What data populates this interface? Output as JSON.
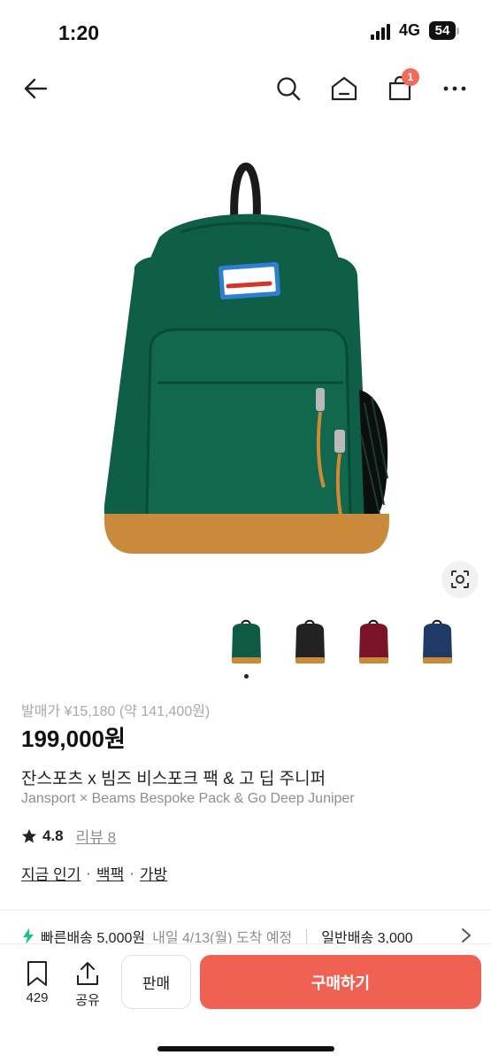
{
  "status_bar": {
    "time": "1:20",
    "network": "4G",
    "battery": "54"
  },
  "nav": {
    "cart_count": "1"
  },
  "product": {
    "release_price": "발매가 ¥15,180 (약 141,400원)",
    "price": "199,000원",
    "title_ko": "잔스포츠 x 빔즈 비스포크 팩 & 고 딥 주니퍼",
    "title_en": "Jansport × Beams Bespoke Pack & Go Deep Juniper",
    "rating": "4.8",
    "review_label": "리뷰 8",
    "tags": [
      "지금 인기",
      "백팩",
      "가방"
    ],
    "tag_separator": "·"
  },
  "thumbnails": {
    "colors": [
      "#0e5a45",
      "#222222",
      "#7a1428",
      "#1f3a66"
    ],
    "selected_index": 0
  },
  "delivery": {
    "fast_label": "빠른배송 5,000원",
    "fast_eta": "내일 4/13(월) 도착 예정",
    "standard_label": "일반배송 3,000"
  },
  "bottom_bar": {
    "bookmark_count": "429",
    "share_label": "공유",
    "sell_label": "판매",
    "buy_label": "구매하기"
  },
  "colors": {
    "accent": "#ef6253",
    "badge": "#f26a5b",
    "bag_green": "#0e5a45",
    "suede": "#c98a3c",
    "logo_blue": "#2f7fd0",
    "bolt_green": "#19c27a"
  }
}
